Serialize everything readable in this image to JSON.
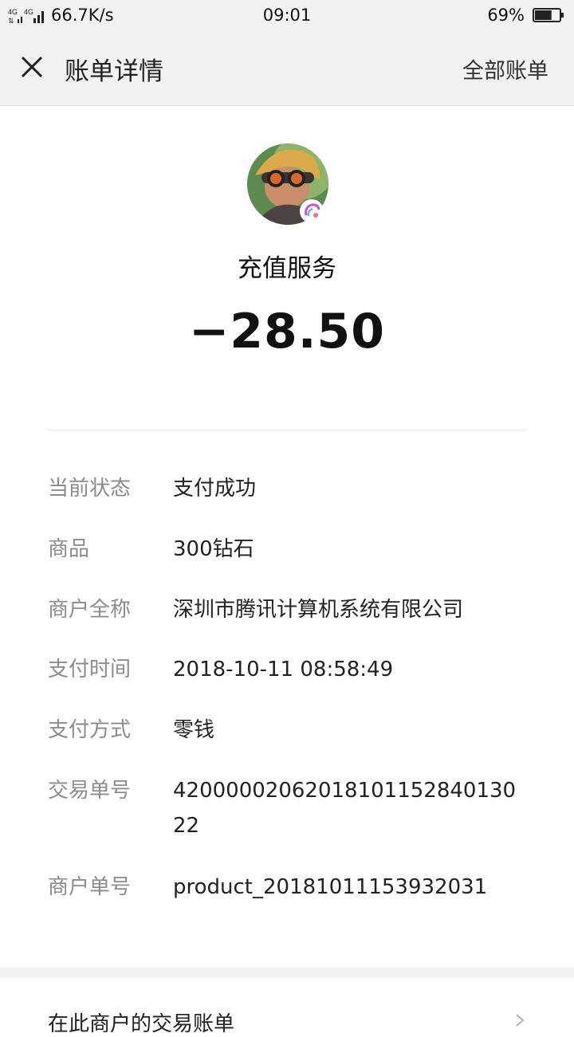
{
  "status_bar": {
    "network": "4G 4G",
    "speed": "66.7K/s",
    "time": "09:01",
    "battery": "69%",
    "battery_level": 0.69
  },
  "nav": {
    "title": "账单详情",
    "right_link": "全部账单"
  },
  "merchant": {
    "name": "充值服务",
    "amount": "−28.50"
  },
  "details": [
    {
      "label": "当前状态",
      "value": "支付成功"
    },
    {
      "label": "商品",
      "value": "300钻石"
    },
    {
      "label": "商户全称",
      "value": "深圳市腾讯计算机系统有限公司"
    },
    {
      "label": "支付时间",
      "value": "2018-10-11 08:58:49"
    },
    {
      "label": "支付方式",
      "value": "零钱"
    },
    {
      "label": "交易单号",
      "value": "4200000206201810115284013022"
    },
    {
      "label": "商户单号",
      "value": "product_20181011153932031"
    }
  ],
  "footer": {
    "label": "在此商户的交易账单"
  }
}
